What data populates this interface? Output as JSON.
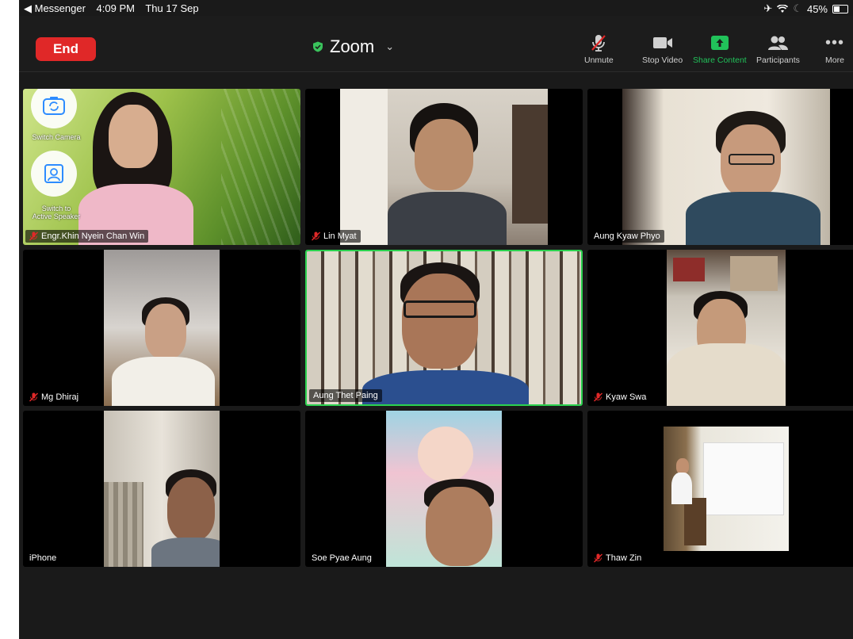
{
  "status_bar": {
    "back_app": "◀ Messenger",
    "time": "4:09 PM",
    "date": "Thu 17 Sep",
    "battery": "45%"
  },
  "toolbar": {
    "end_label": "End",
    "meeting_title": "Zoom",
    "unmute_label": "Unmute",
    "stop_video_label": "Stop Video",
    "share_content_label": "Share Content",
    "participants_label": "Participants",
    "more_label": "More"
  },
  "camera_controls": {
    "switch_camera_label": "Switch Camera",
    "active_speaker_label_1": "Switch to",
    "active_speaker_label_2": "Active Speaker"
  },
  "participants": [
    {
      "name": "Engr.Khin Nyein Chan Win",
      "muted": true
    },
    {
      "name": "Lin Myat",
      "muted": true
    },
    {
      "name": "Aung Kyaw Phyo",
      "muted": false
    },
    {
      "name": "Mg Dhiraj",
      "muted": true
    },
    {
      "name": "Aung Thet Paing",
      "muted": false,
      "active_speaker": true
    },
    {
      "name": "Kyaw Swa",
      "muted": true
    },
    {
      "name": "iPhone",
      "muted": false
    },
    {
      "name": "Soe Pyae Aung",
      "muted": false
    },
    {
      "name": "Thaw Zin",
      "muted": true
    }
  ],
  "colors": {
    "end_button": "#e02828",
    "active_speaker_border": "#2bd24f",
    "share_content": "#21c25a",
    "mute_icon": "#e02828",
    "background": "#1a1a1a"
  }
}
